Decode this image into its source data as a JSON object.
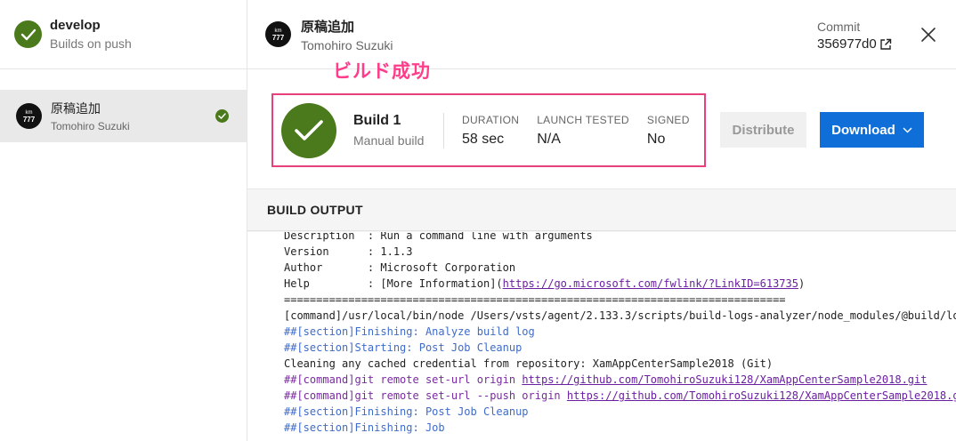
{
  "sidebar": {
    "branch_name": "develop",
    "branch_subtitle": "Builds on push",
    "build_item": {
      "title": "原稿追加",
      "author": "Tomohiro Suzuki",
      "avatar_top": "km",
      "avatar_bottom": "777"
    }
  },
  "header": {
    "title": "原稿追加",
    "author": "Tomohiro Suzuki",
    "avatar_top": "km",
    "avatar_bottom": "777",
    "commit_label": "Commit",
    "commit_hash": "356977d0"
  },
  "annotation": "ビルド成功",
  "summary": {
    "build_name": "Build 1",
    "build_type": "Manual build",
    "stats": [
      {
        "label": "DURATION",
        "value": "58 sec"
      },
      {
        "label": "LAUNCH TESTED",
        "value": "N/A"
      },
      {
        "label": "SIGNED",
        "value": "No"
      }
    ]
  },
  "actions": {
    "distribute_label": "Distribute",
    "download_label": "Download"
  },
  "output": {
    "title": "BUILD OUTPUT",
    "lines": [
      {
        "text": "Description  : Run a command line with arguments",
        "kind": "normal"
      },
      {
        "text": "Version      : 1.1.3",
        "kind": "normal"
      },
      {
        "text": "Author       : Microsoft Corporation",
        "kind": "normal"
      },
      {
        "text": "Help         : [More Information](",
        "link": "https://go.microsoft.com/fwlink/?LinkID=613735",
        "suffix": ")",
        "kind": "normal"
      },
      {
        "text": "==============================================================================",
        "kind": "normal"
      },
      {
        "text": "[command]/usr/local/bin/node /Users/vsts/agent/2.133.3/scripts/build-logs-analyzer/node_modules/@build/lo",
        "kind": "normal"
      },
      {
        "text": "##[section]Finishing: Analyze build log",
        "kind": "section"
      },
      {
        "text": "##[section]Starting: Post Job Cleanup",
        "kind": "section"
      },
      {
        "text": "Cleaning any cached credential from repository: XamAppCenterSample2018 (Git)",
        "kind": "normal"
      },
      {
        "text": "##[command]git remote set-url origin ",
        "link": "https://github.com/TomohiroSuzuki128/XamAppCenterSample2018.git",
        "kind": "command"
      },
      {
        "text": "##[command]git remote set-url --push origin ",
        "link": "https://github.com/TomohiroSuzuki128/XamAppCenterSample2018.g",
        "kind": "command"
      },
      {
        "text": "##[section]Finishing: Post Job Cleanup",
        "kind": "section"
      },
      {
        "text": "##[section]Finishing: Job",
        "kind": "section"
      }
    ]
  },
  "colors": {
    "success": "#4a7a1b",
    "primary": "#0f6ed8",
    "highlight": "#e8407c",
    "annotation": "#ff3d8b"
  },
  "icons": {
    "check": "check-icon",
    "external": "external-link-icon",
    "close": "close-icon",
    "chevron": "chevron-down-icon"
  }
}
